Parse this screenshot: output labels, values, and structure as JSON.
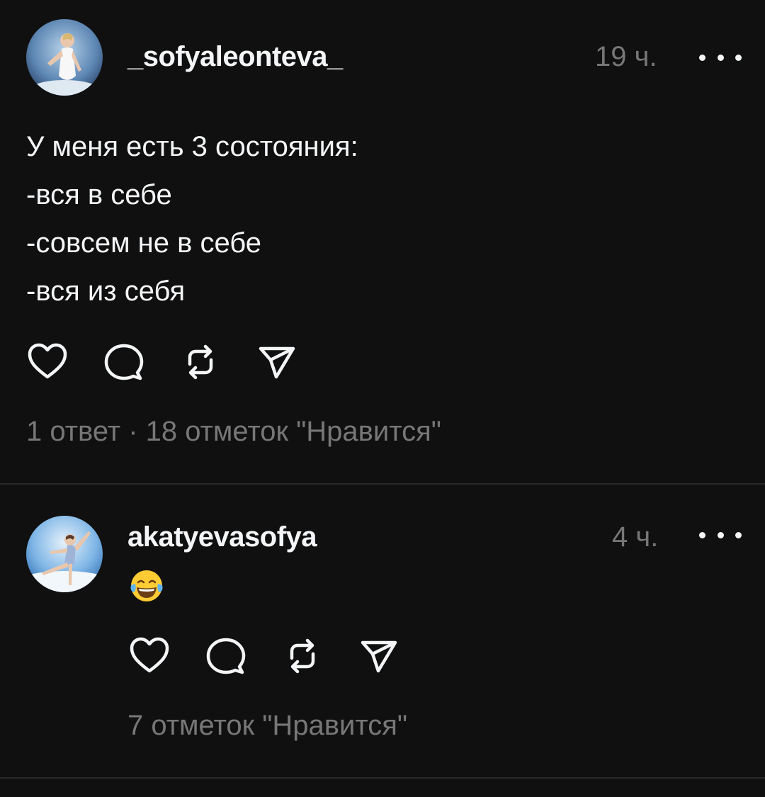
{
  "colors": {
    "background": "#101010",
    "text_primary": "#f3f5f7",
    "text_secondary": "#777777",
    "divider": "#2a2a2a"
  },
  "posts": [
    {
      "username": "_sofyaleonteva_",
      "time": "19 ч.",
      "text_lines": [
        "У меня есть 3 состояния:",
        "-вся в себе",
        "-совсем не в себе",
        "-вся из себя"
      ],
      "actions": [
        "heart-icon",
        "comment-icon",
        "repost-icon",
        "share-icon"
      ],
      "replies": "1 ответ",
      "separator": " · ",
      "likes": "18 отметок \"Нравится\""
    },
    {
      "username": "akatyevasofya",
      "time": "4 ч.",
      "emoji": "😂",
      "actions": [
        "heart-icon",
        "comment-icon",
        "repost-icon",
        "share-icon"
      ],
      "likes": "7 отметок \"Нравится\""
    }
  ]
}
